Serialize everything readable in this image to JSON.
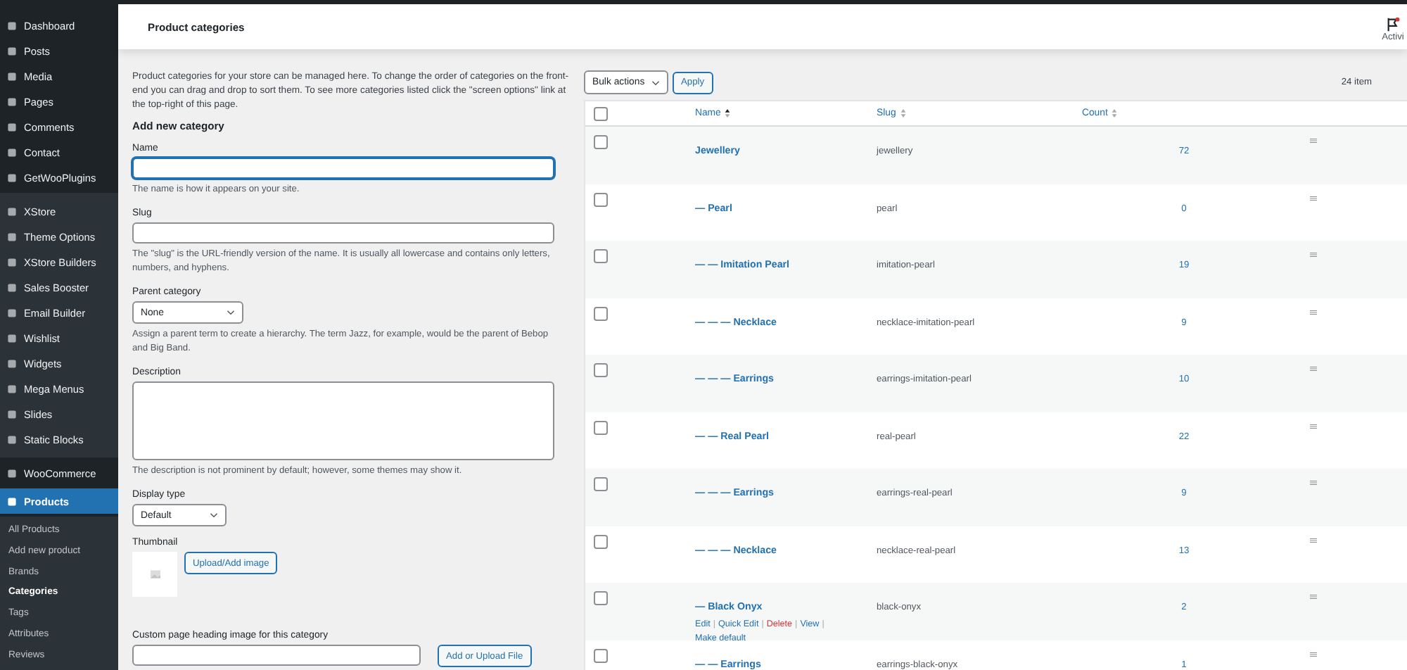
{
  "sidebar": {
    "groups": [
      {
        "shaded": false,
        "items": [
          {
            "label": "Dashboard",
            "selected": false
          },
          {
            "label": "Posts",
            "selected": false
          },
          {
            "label": "Media",
            "selected": false
          },
          {
            "label": "Pages",
            "selected": false
          },
          {
            "label": "Comments",
            "selected": false
          },
          {
            "label": "Contact",
            "selected": false
          },
          {
            "label": "GetWooPlugins",
            "selected": false
          }
        ]
      },
      {
        "shaded": true,
        "items": [
          {
            "label": "XStore",
            "selected": false
          },
          {
            "label": "Theme Options",
            "selected": false
          },
          {
            "label": "XStore Builders",
            "selected": false
          },
          {
            "label": "Sales Booster",
            "selected": false
          },
          {
            "label": "Email Builder",
            "selected": false
          },
          {
            "label": "Wishlist",
            "selected": false
          },
          {
            "label": "Widgets",
            "selected": false
          },
          {
            "label": "Mega Menus",
            "selected": false
          },
          {
            "label": "Slides",
            "selected": false
          },
          {
            "label": "Static Blocks",
            "selected": false
          }
        ]
      },
      {
        "shaded": false,
        "items": [
          {
            "label": "WooCommerce",
            "selected": false
          },
          {
            "label": "Products",
            "selected": true
          }
        ]
      }
    ],
    "submenu": [
      {
        "label": "All Products",
        "selected": false
      },
      {
        "label": "Add new product",
        "selected": false
      },
      {
        "label": "Brands",
        "selected": false
      },
      {
        "label": "Categories",
        "selected": true
      },
      {
        "label": "Tags",
        "selected": false
      },
      {
        "label": "Attributes",
        "selected": false
      },
      {
        "label": "Reviews",
        "selected": false
      }
    ]
  },
  "header": {
    "title": "Product categories",
    "activity": "Activi"
  },
  "form": {
    "intro": "Product categories for your store can be managed here. To change the order of categories on the front-end you can drag and drop to sort them. To see more categories listed click the \"screen options\" link at the top-right of this page.",
    "heading": "Add new category",
    "name": {
      "label": "Name",
      "focused": true,
      "help": "The name is how it appears on your site."
    },
    "slug": {
      "label": "Slug",
      "focused": false,
      "help": "The \"slug\" is the URL-friendly version of the name. It is usually all lowercase and contains only letters, numbers, and hyphens."
    },
    "parent": {
      "label": "Parent category",
      "value": "None",
      "help": "Assign a parent term to create a hierarchy. The term Jazz, for example, would be the parent of Bebop and Big Band."
    },
    "description": {
      "label": "Description",
      "help": "The description is not prominent by default; however, some themes may show it."
    },
    "display_type": {
      "label": "Display type",
      "value": "Default"
    },
    "thumbnail": {
      "label": "Thumbnail",
      "button": "Upload/Add image"
    },
    "heading_image": {
      "label": "Custom page heading image for this category",
      "button": "Add or Upload File"
    }
  },
  "table": {
    "bulk_actions": "Bulk actions",
    "apply": "Apply",
    "count": "24 item",
    "select_all_checked": false,
    "columns": [
      {
        "label": "Name",
        "sorted": true
      },
      {
        "label": "Slug",
        "sorted": false
      },
      {
        "label": "Count",
        "sorted": false
      }
    ],
    "rows": [
      {
        "name": "Jewellery",
        "slug": "jewellery",
        "count": "72",
        "checked": false
      },
      {
        "name": "— Pearl",
        "slug": "pearl",
        "count": "0",
        "checked": false
      },
      {
        "name": "— — Imitation Pearl",
        "slug": "imitation-pearl",
        "count": "19",
        "checked": false
      },
      {
        "name": "— — — Necklace",
        "slug": "necklace-imitation-pearl",
        "count": "9",
        "checked": false
      },
      {
        "name": "— — — Earrings",
        "slug": "earrings-imitation-pearl",
        "count": "10",
        "checked": false
      },
      {
        "name": "— — Real Pearl",
        "slug": "real-pearl",
        "count": "22",
        "checked": false
      },
      {
        "name": "— — — Earrings",
        "slug": "earrings-real-pearl",
        "count": "9",
        "checked": false
      },
      {
        "name": "— — — Necklace",
        "slug": "necklace-real-pearl",
        "count": "13",
        "checked": false
      },
      {
        "name": "— Black Onyx",
        "slug": "black-onyx",
        "count": "2",
        "checked": false,
        "actions": [
          {
            "label": "Edit",
            "kind": "link",
            "separator": "|"
          },
          {
            "label": "Quick Edit",
            "kind": "link",
            "separator": "|"
          },
          {
            "label": "Delete",
            "kind": "delete",
            "separator": "|"
          },
          {
            "label": "View",
            "kind": "link",
            "separator": "|"
          },
          {
            "label": "Make default",
            "kind": "link"
          }
        ]
      },
      {
        "name": "— — Earrings",
        "slug": "earrings-black-onyx",
        "count": "1",
        "checked": false
      }
    ]
  }
}
